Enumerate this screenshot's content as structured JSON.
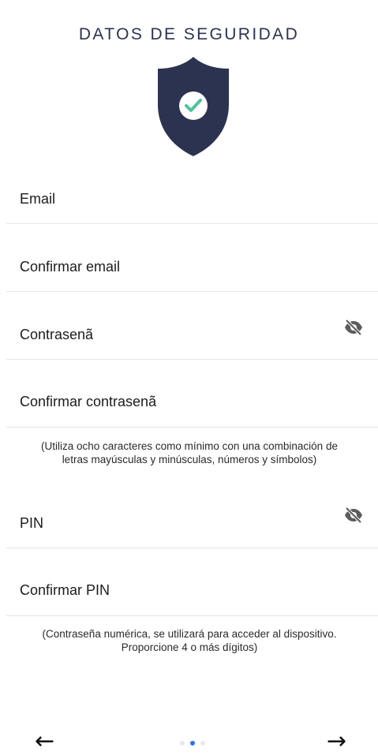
{
  "header": {
    "title": "DATOS DE SEGURIDAD"
  },
  "icons": {
    "shield": "shield-check-icon",
    "eye_off": "eye-off-icon",
    "back": "arrow-left-icon",
    "next": "arrow-right-icon"
  },
  "colors": {
    "shield": "#2b3350",
    "check": "#4cc59a",
    "active_dot": "#2f73e6",
    "inactive_dot": "#e4e8ef"
  },
  "form": {
    "email_label": "Email",
    "confirm_email_label": "Confirmar email",
    "password_label": "Contrasenã",
    "confirm_password_label": "Confirmar contrasenã",
    "password_hint": "(Utiliza ocho caracteres como mínimo con una combinación de letras mayúsculas y minúsculas, números y símbolos)",
    "pin_label": "PIN",
    "confirm_pin_label": "Confirmar PIN",
    "pin_hint": "(Contraseña numérica, se utilizará para acceder al dispositivo. Proporcione 4 o más dígitos)"
  },
  "navigation": {
    "back_glyph": "←",
    "next_glyph": "→",
    "page_count": 3,
    "current_page": 2
  }
}
